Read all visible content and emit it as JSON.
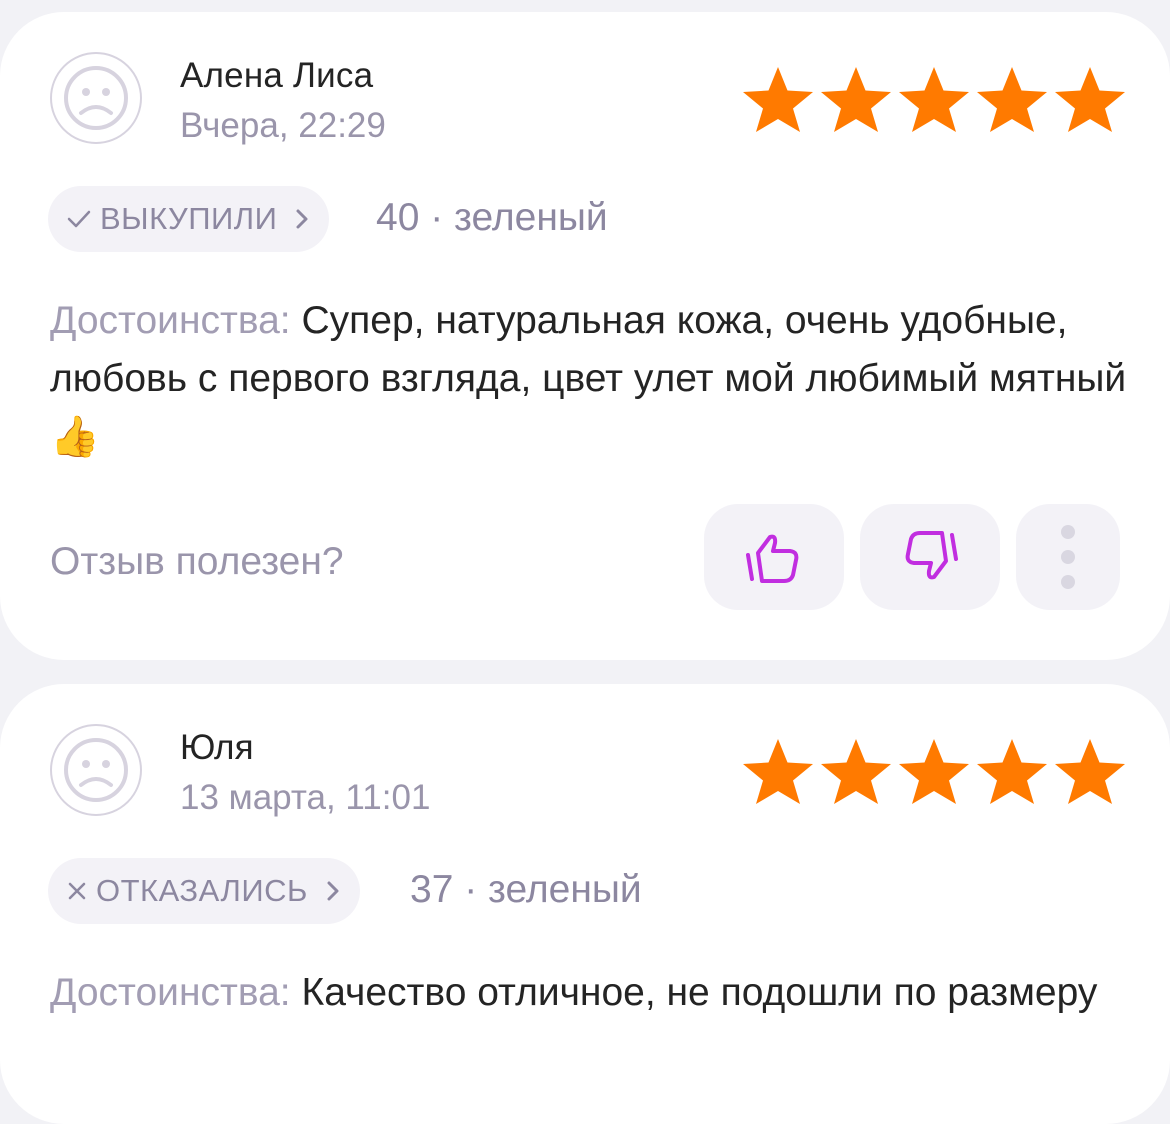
{
  "colors": {
    "star": "#ff7a00",
    "accent": "#c12ee0",
    "muted": "#9a95ab",
    "text": "#242424"
  },
  "reviews": [
    {
      "author": "Алена Лиса",
      "date": "Вчера, 22:29",
      "rating": 5,
      "status_icon": "check-icon",
      "status_text": "ВЫКУПИЛИ",
      "variant": "40 · зеленый",
      "label": "Достоинства:",
      "text": "Супер, натуральная кожа, очень удобные, любовь с первого взгляда, цвет улет мой любимый мятный",
      "emoji": "👍"
    },
    {
      "author": "Юля",
      "date": "13 марта, 11:01",
      "rating": 5,
      "status_icon": "cross-icon",
      "status_text": "ОТКАЗАЛИСЬ",
      "variant": "37 · зеленый",
      "label": "Достоинства:",
      "text": "Качество отличное, не подошли по размеру"
    }
  ],
  "helpful_prompt": "Отзыв полезен?",
  "icons": {
    "avatar": "sad-face-icon",
    "like": "thumb-up-icon",
    "dislike": "thumb-down-icon",
    "more": "more-vertical-icon",
    "badge_arrow": "chevron-right-icon"
  }
}
